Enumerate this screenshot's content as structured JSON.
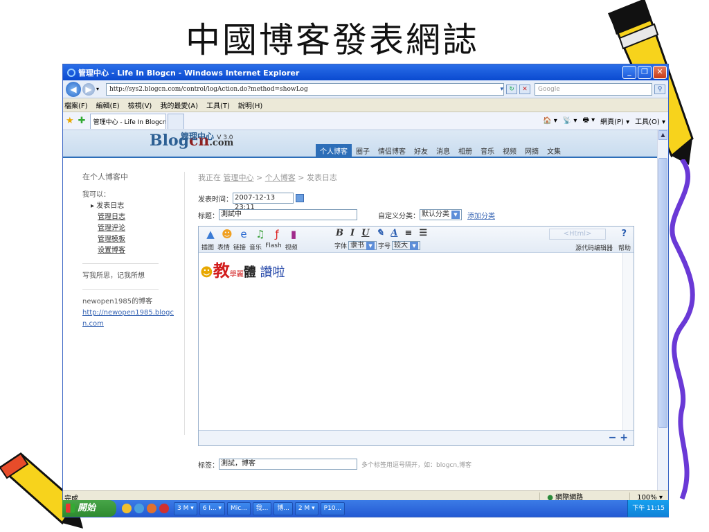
{
  "slide_title": "中國博客發表網誌",
  "window": {
    "title": "管理中心 - Life In Blogcn - Windows Internet Explorer",
    "controls": [
      "_",
      "❐",
      "✕"
    ]
  },
  "address": {
    "url": "http://sys2.blogcn.com/control/logAction.do?method=showLog",
    "search_placeholder": "Google"
  },
  "menubar": [
    "檔案(F)",
    "編輯(E)",
    "檢視(V)",
    "我的最愛(A)",
    "工具(T)",
    "說明(H)"
  ],
  "tab": {
    "label": "管理中心 - Life In Blogcn",
    "tools": [
      "🏠 ▾",
      "📡 ▾",
      "🖶 ▾",
      "網頁(P) ▾",
      "工具(O) ▾"
    ]
  },
  "blog": {
    "logo_b": "Blog",
    "logo_cn": "cn",
    "logo_com": ".com",
    "mgr_title": "管理中心",
    "mgr_version": "V 3.0",
    "nav": [
      "个人博客",
      "圈子",
      "情侣博客",
      "好友",
      "消息",
      "相册",
      "音乐",
      "视频",
      "网摘",
      "文集"
    ]
  },
  "left": {
    "heading": "在个人博客中",
    "can": "我可以：",
    "current": "▸ 发表日志",
    "links": [
      "管理日志",
      "管理评论",
      "管理模板",
      "设置博客"
    ],
    "motto": "写我所思，记我所想",
    "owner": "newopen1985的博客",
    "owner_url": "http://newopen1985.blogcn.com"
  },
  "main": {
    "crumb_prefix": "我正在",
    "crumb1": "管理中心",
    "crumb2": "个人博客",
    "crumb3": "发表日志",
    "time_label": "发表时间：",
    "time_value": "2007-12-13 23:11",
    "title_label": "标题：",
    "title_value": "測試中",
    "cat_label": "自定义分类：",
    "cat_value": "默认分类",
    "add_cat": "添加分类",
    "tools": [
      "插图",
      "表情",
      "链接",
      "音乐",
      "Flash",
      "视频"
    ],
    "font_label": "字体",
    "font_value": "隶书",
    "size_label": "字号",
    "size_value": "较大",
    "html_btn": "<Html>",
    "help_q": "?",
    "src_label": "源代码编辑器",
    "help_label": "帮助",
    "content_big": "教",
    "content_small": "學麗",
    "content_bold": "體",
    "content_rest": "讚啦",
    "minus_plus": "− +",
    "tag_label": "标签：",
    "tag_value": "測試，博客",
    "tag_hint": "多个标签用逗号隔开，如：blogcn,博客"
  },
  "status": {
    "left": "完成",
    "zone": "網際網路",
    "zoom": "100%"
  },
  "taskbar": {
    "start": "開始",
    "items": [
      "3 M ▾",
      "6 I... ▾",
      "Mic...",
      "我...",
      "博...",
      "2 M ▾",
      "P10..."
    ],
    "clock": "下午 11:15"
  }
}
